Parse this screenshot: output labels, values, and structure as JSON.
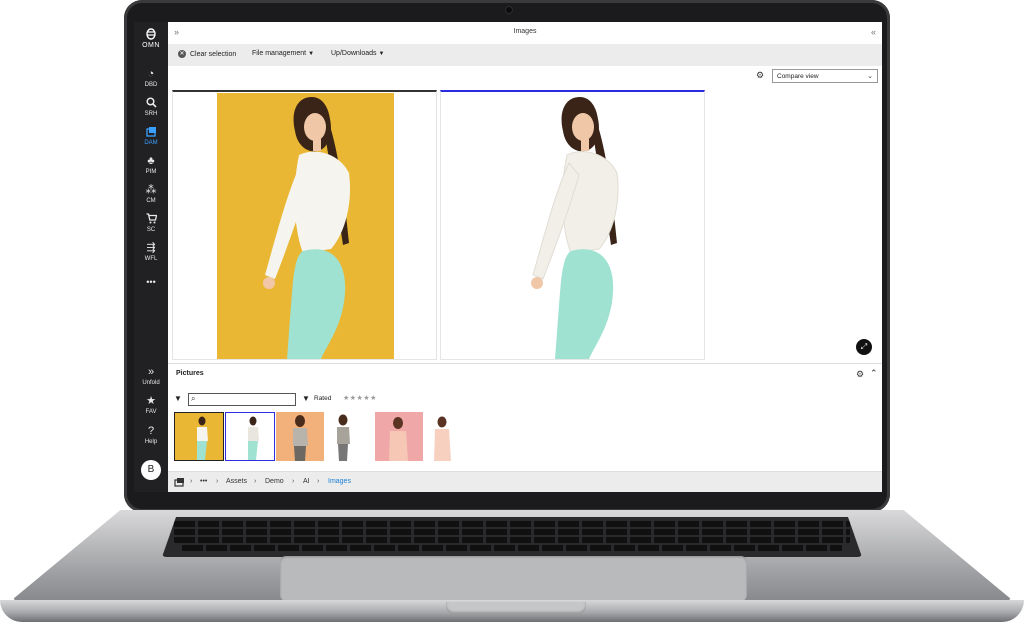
{
  "app": {
    "logo_text": "OMN",
    "window_title": "Images"
  },
  "sidebar": {
    "items": [
      {
        "label": "DBD",
        "icon": "dashboard-icon"
      },
      {
        "label": "SRH",
        "icon": "search-icon"
      },
      {
        "label": "DAM",
        "icon": "images-icon",
        "active": true
      },
      {
        "label": "PIM",
        "icon": "pim-icon"
      },
      {
        "label": "CM",
        "icon": "network-icon"
      },
      {
        "label": "SC",
        "icon": "cart-icon"
      },
      {
        "label": "WFL",
        "icon": "workflow-icon"
      },
      {
        "label": "•••",
        "icon": "more-icon"
      }
    ],
    "bottom": [
      {
        "label": "Unfold",
        "icon": "unfold-icon"
      },
      {
        "label": "FAV",
        "icon": "star-icon"
      },
      {
        "label": "Help",
        "icon": "help-icon"
      }
    ],
    "avatar_initial": "B"
  },
  "toolbar": {
    "clear_selection": "Clear selection",
    "file_management": "File management",
    "up_downloads": "Up/Downloads"
  },
  "view": {
    "selected": "Compare view"
  },
  "pictures": {
    "title": "Pictures",
    "search_value": "",
    "rated_label": "Rated",
    "stars": "★★★★★",
    "thumbnails": [
      {
        "name": "yellow-background",
        "bg": "#e9b733",
        "selected": "yellow"
      },
      {
        "name": "white-cutout",
        "bg": "#ffffff",
        "selected": "blue"
      },
      {
        "name": "orange-background",
        "bg": "#f2b07a"
      },
      {
        "name": "white-background",
        "bg": "#ffffff"
      },
      {
        "name": "pink-background",
        "bg": "#f0a7a8"
      },
      {
        "name": "white-background-2",
        "bg": "#ffffff"
      }
    ]
  },
  "breadcrumb": {
    "dots": "•••",
    "items": [
      "Assets",
      "Demo",
      "AI",
      "Images"
    ]
  },
  "colors": {
    "accent": "#1a7fd4",
    "selection_blue": "#2b2be0",
    "yellow": "#e9b733"
  }
}
